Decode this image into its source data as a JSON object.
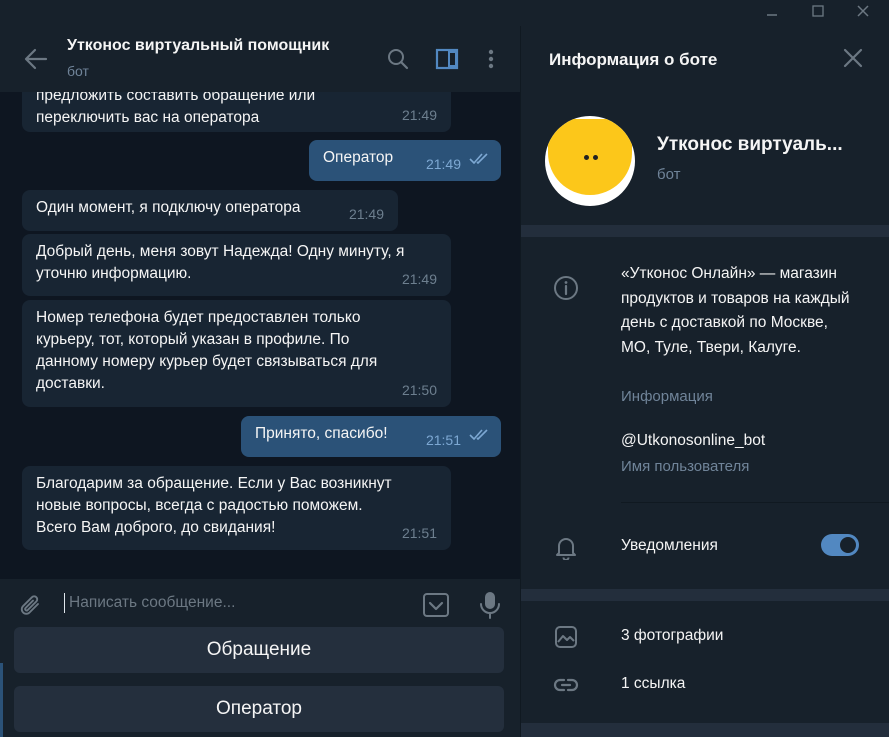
{
  "window": {
    "minimize_icon": "minimize-icon",
    "maximize_icon": "maximize-icon",
    "close_icon": "close-icon"
  },
  "chat": {
    "title": "Утконос виртуальный помощник",
    "subtitle": "бот",
    "header_icons": [
      "back-arrow-icon",
      "search-icon",
      "sidebar-toggle-icon",
      "more-vertical-icon"
    ],
    "messages": [
      {
        "direction": "in",
        "text": "предложить составить обращение или\nпереключить вас на оператора",
        "time": "21:49"
      },
      {
        "direction": "out",
        "text": "Оператор",
        "time": "21:49",
        "status": "read"
      },
      {
        "direction": "in",
        "text": "Один момент, я подключу оператора",
        "time": "21:49"
      },
      {
        "direction": "in",
        "text": "Добрый день, меня зовут Надежда! Одну минуту, я\nуточню информацию.",
        "time": "21:49"
      },
      {
        "direction": "in",
        "text": "Номер телефона будет предоставлен только\nкурьеру, тот, который указан в профиле. По\nданному номеру курьер будет связываться для\nдоставки.",
        "time": "21:50"
      },
      {
        "direction": "out",
        "text": "Принято, спасибо!",
        "time": "21:51",
        "status": "read"
      },
      {
        "direction": "in",
        "text": "Благодарим за обращение. Если у Вас возникнут\nновые вопросы, всегда с радостью поможем.\nВсего Вам доброго, до свидания!",
        "time": "21:51"
      }
    ],
    "composer": {
      "placeholder": "Написать сообщение...",
      "icons": [
        "attach-icon",
        "bot-keyboard-icon",
        "microphone-icon"
      ]
    },
    "keyboard_buttons": [
      "Обращение",
      "Оператор"
    ]
  },
  "info": {
    "title": "Информация о боте",
    "name": "Утконос виртуаль...",
    "subtitle": "бот",
    "description": "«Утконос Онлайн» — магазин продуктов и товаров на каждый день с доставкой по Москве, МО, Туле, Твери, Калуге.",
    "description_label": "Информация",
    "username": "@Utkonosonline_bot",
    "username_label": "Имя пользователя",
    "notifications_label": "Уведомления",
    "notifications_on": true,
    "photos": "3 фотографии",
    "links": "1 ссылка"
  },
  "colors": {
    "accent": "#5288c1",
    "outgoing_bubble": "#2b5278",
    "incoming_bubble": "#182533",
    "panel": "#17212b",
    "background": "#0e1621",
    "avatar_yellow": "#fcc71a"
  }
}
